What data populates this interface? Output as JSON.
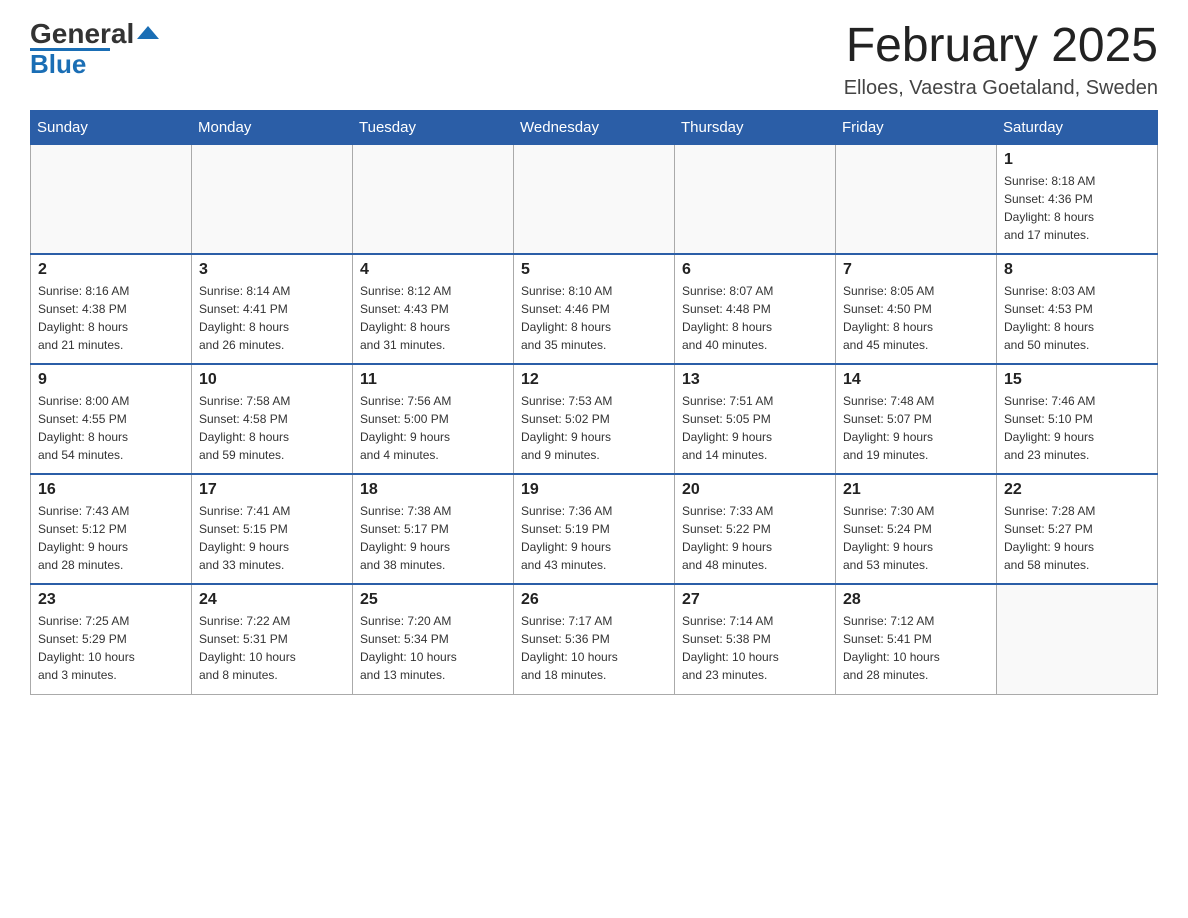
{
  "header": {
    "logo_text1": "General",
    "logo_text2": "Blue",
    "month_title": "February 2025",
    "location": "Elloes, Vaestra Goetaland, Sweden"
  },
  "weekdays": [
    "Sunday",
    "Monday",
    "Tuesday",
    "Wednesday",
    "Thursday",
    "Friday",
    "Saturday"
  ],
  "weeks": [
    [
      {
        "day": "",
        "info": ""
      },
      {
        "day": "",
        "info": ""
      },
      {
        "day": "",
        "info": ""
      },
      {
        "day": "",
        "info": ""
      },
      {
        "day": "",
        "info": ""
      },
      {
        "day": "",
        "info": ""
      },
      {
        "day": "1",
        "info": "Sunrise: 8:18 AM\nSunset: 4:36 PM\nDaylight: 8 hours\nand 17 minutes."
      }
    ],
    [
      {
        "day": "2",
        "info": "Sunrise: 8:16 AM\nSunset: 4:38 PM\nDaylight: 8 hours\nand 21 minutes."
      },
      {
        "day": "3",
        "info": "Sunrise: 8:14 AM\nSunset: 4:41 PM\nDaylight: 8 hours\nand 26 minutes."
      },
      {
        "day": "4",
        "info": "Sunrise: 8:12 AM\nSunset: 4:43 PM\nDaylight: 8 hours\nand 31 minutes."
      },
      {
        "day": "5",
        "info": "Sunrise: 8:10 AM\nSunset: 4:46 PM\nDaylight: 8 hours\nand 35 minutes."
      },
      {
        "day": "6",
        "info": "Sunrise: 8:07 AM\nSunset: 4:48 PM\nDaylight: 8 hours\nand 40 minutes."
      },
      {
        "day": "7",
        "info": "Sunrise: 8:05 AM\nSunset: 4:50 PM\nDaylight: 8 hours\nand 45 minutes."
      },
      {
        "day": "8",
        "info": "Sunrise: 8:03 AM\nSunset: 4:53 PM\nDaylight: 8 hours\nand 50 minutes."
      }
    ],
    [
      {
        "day": "9",
        "info": "Sunrise: 8:00 AM\nSunset: 4:55 PM\nDaylight: 8 hours\nand 54 minutes."
      },
      {
        "day": "10",
        "info": "Sunrise: 7:58 AM\nSunset: 4:58 PM\nDaylight: 8 hours\nand 59 minutes."
      },
      {
        "day": "11",
        "info": "Sunrise: 7:56 AM\nSunset: 5:00 PM\nDaylight: 9 hours\nand 4 minutes."
      },
      {
        "day": "12",
        "info": "Sunrise: 7:53 AM\nSunset: 5:02 PM\nDaylight: 9 hours\nand 9 minutes."
      },
      {
        "day": "13",
        "info": "Sunrise: 7:51 AM\nSunset: 5:05 PM\nDaylight: 9 hours\nand 14 minutes."
      },
      {
        "day": "14",
        "info": "Sunrise: 7:48 AM\nSunset: 5:07 PM\nDaylight: 9 hours\nand 19 minutes."
      },
      {
        "day": "15",
        "info": "Sunrise: 7:46 AM\nSunset: 5:10 PM\nDaylight: 9 hours\nand 23 minutes."
      }
    ],
    [
      {
        "day": "16",
        "info": "Sunrise: 7:43 AM\nSunset: 5:12 PM\nDaylight: 9 hours\nand 28 minutes."
      },
      {
        "day": "17",
        "info": "Sunrise: 7:41 AM\nSunset: 5:15 PM\nDaylight: 9 hours\nand 33 minutes."
      },
      {
        "day": "18",
        "info": "Sunrise: 7:38 AM\nSunset: 5:17 PM\nDaylight: 9 hours\nand 38 minutes."
      },
      {
        "day": "19",
        "info": "Sunrise: 7:36 AM\nSunset: 5:19 PM\nDaylight: 9 hours\nand 43 minutes."
      },
      {
        "day": "20",
        "info": "Sunrise: 7:33 AM\nSunset: 5:22 PM\nDaylight: 9 hours\nand 48 minutes."
      },
      {
        "day": "21",
        "info": "Sunrise: 7:30 AM\nSunset: 5:24 PM\nDaylight: 9 hours\nand 53 minutes."
      },
      {
        "day": "22",
        "info": "Sunrise: 7:28 AM\nSunset: 5:27 PM\nDaylight: 9 hours\nand 58 minutes."
      }
    ],
    [
      {
        "day": "23",
        "info": "Sunrise: 7:25 AM\nSunset: 5:29 PM\nDaylight: 10 hours\nand 3 minutes."
      },
      {
        "day": "24",
        "info": "Sunrise: 7:22 AM\nSunset: 5:31 PM\nDaylight: 10 hours\nand 8 minutes."
      },
      {
        "day": "25",
        "info": "Sunrise: 7:20 AM\nSunset: 5:34 PM\nDaylight: 10 hours\nand 13 minutes."
      },
      {
        "day": "26",
        "info": "Sunrise: 7:17 AM\nSunset: 5:36 PM\nDaylight: 10 hours\nand 18 minutes."
      },
      {
        "day": "27",
        "info": "Sunrise: 7:14 AM\nSunset: 5:38 PM\nDaylight: 10 hours\nand 23 minutes."
      },
      {
        "day": "28",
        "info": "Sunrise: 7:12 AM\nSunset: 5:41 PM\nDaylight: 10 hours\nand 28 minutes."
      },
      {
        "day": "",
        "info": ""
      }
    ]
  ]
}
